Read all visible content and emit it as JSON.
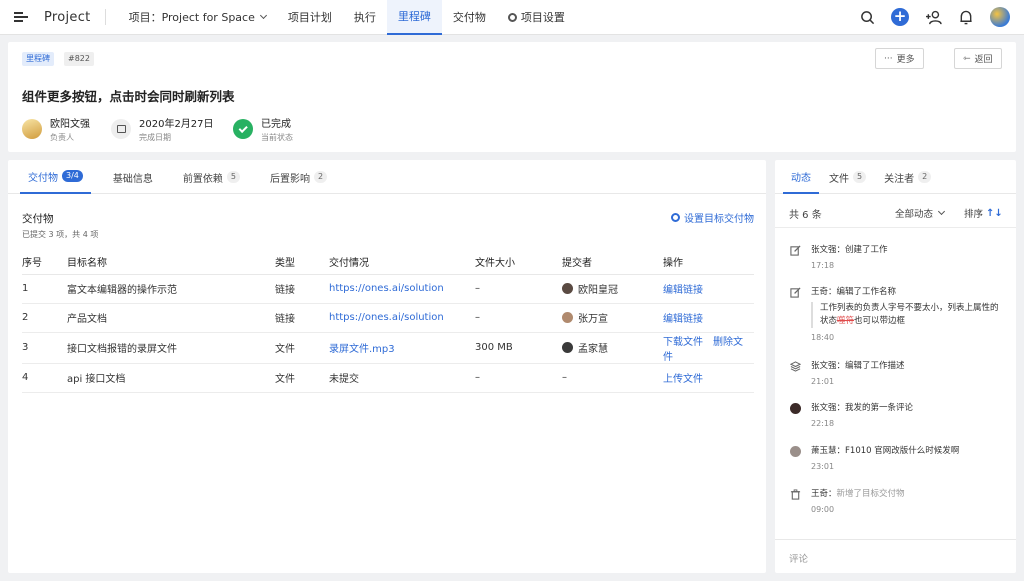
{
  "nav": {
    "brand": "Project",
    "project_label": "项目：Project for Space",
    "items": [
      "项目计划",
      "执行",
      "里程碑",
      "交付物",
      "项目设置"
    ],
    "active": "里程碑"
  },
  "header": {
    "badge": "里程碑",
    "id": "#822",
    "more": "更多",
    "back": "返回",
    "title": "组件更多按钮，点击时会同时刷新列表",
    "owner": {
      "value": "欧阳文强",
      "label": "负责人"
    },
    "date": {
      "value": "2020年2月27日",
      "label": "完成日期"
    },
    "status": {
      "value": "已完成",
      "label": "当前状态"
    }
  },
  "main": {
    "tabs": [
      {
        "label": "交付物",
        "count": "3/4"
      },
      {
        "label": "基础信息",
        "count": ""
      },
      {
        "label": "前置依赖",
        "count": "5"
      },
      {
        "label": "后置影响",
        "count": "2"
      }
    ],
    "section_title": "交付物",
    "section_sub": "已提交 3 项，共 4 项",
    "set_target": "设置目标交付物",
    "columns": [
      "序号",
      "目标名称",
      "类型",
      "交付情况",
      "文件大小",
      "提交者",
      "操作"
    ],
    "rows": [
      {
        "no": "1",
        "name": "富文本编辑器的操作示范",
        "type": "链接",
        "delivery": "https://ones.ai/solution",
        "size": "–",
        "submitter": "欧阳皇冠",
        "ops": [
          "编辑链接"
        ]
      },
      {
        "no": "2",
        "name": "产品文档",
        "type": "链接",
        "delivery": "https://ones.ai/solution",
        "size": "–",
        "submitter": "张万宣",
        "ops": [
          "编辑链接"
        ]
      },
      {
        "no": "3",
        "name": "接口文档报错的录屏文件",
        "type": "文件",
        "delivery": "录屏文件.mp3",
        "size": "300 MB",
        "submitter": "孟家慧",
        "ops": [
          "下载文件",
          "删除文件"
        ]
      },
      {
        "no": "4",
        "name": "api 接口文档",
        "type": "文件",
        "delivery": "未提交",
        "size": "–",
        "submitter": "–",
        "ops": [
          "上传文件"
        ]
      }
    ]
  },
  "side": {
    "tabs": [
      {
        "label": "动态",
        "count": ""
      },
      {
        "label": "文件",
        "count": "5"
      },
      {
        "label": "关注者",
        "count": "2"
      }
    ],
    "total": "共 6 条",
    "filter": "全部动态",
    "sort": "排序",
    "activities": [
      {
        "icon": "edit-icon",
        "actor": "张文强",
        "text": "创建了工作",
        "time": "17:18"
      },
      {
        "icon": "edit-icon",
        "actor": "王奇",
        "text": "编辑了工作名称",
        "quote_a": "工作列表的负责人字号不要太小，列表上属性的状态",
        "quote_strike": "噬符",
        "quote_b": "也可以带边框",
        "time": "18:40"
      },
      {
        "icon": "layers-icon",
        "actor": "张文强",
        "text": "编辑了工作描述",
        "time": "21:01"
      },
      {
        "icon": "avatar",
        "actor": "张文强",
        "text": "我发的第一条评论",
        "time": "22:18"
      },
      {
        "icon": "avatar",
        "actor": "萧玉慧",
        "text": "F1010 官网改版什么时候发啊",
        "time": "23:01"
      },
      {
        "icon": "trash-icon",
        "actor": "王奇",
        "text": "新增了目标交付物",
        "time": "09:00"
      }
    ],
    "comment_placeholder": "评论"
  }
}
